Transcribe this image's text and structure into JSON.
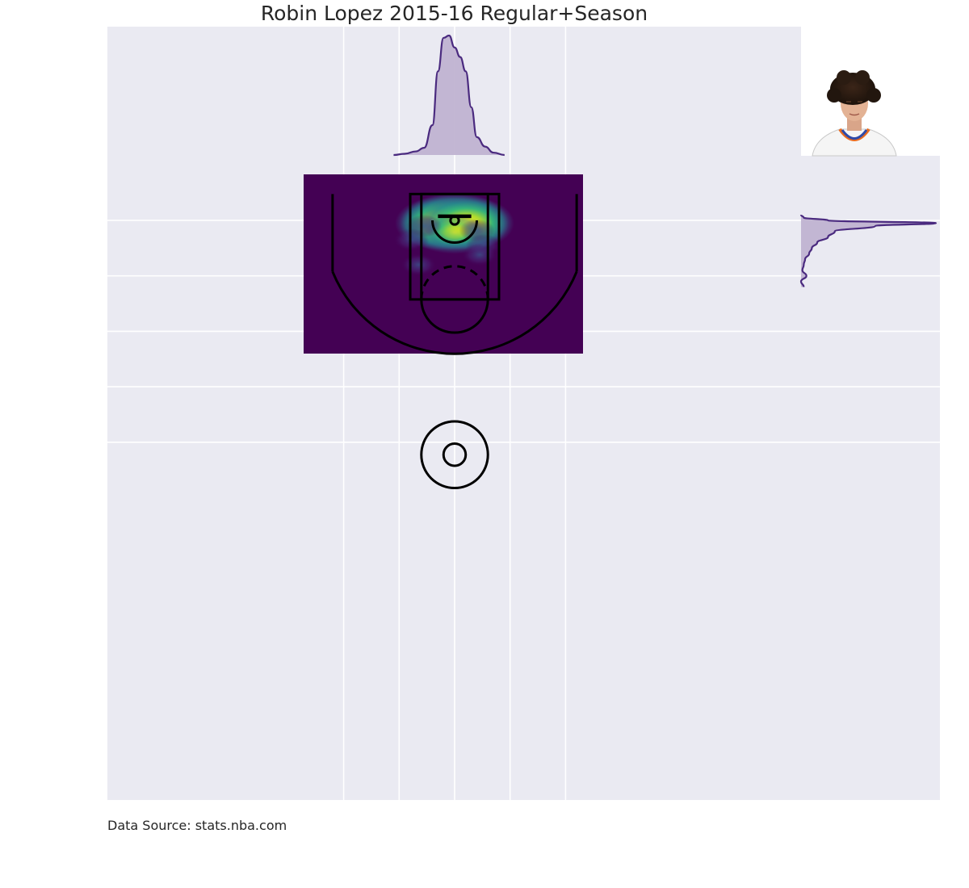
{
  "title": "Robin Lopez 2015-16 Regular+Season",
  "source": "Data Source: stats.nba.com",
  "colors": {
    "background": "#eaeaf2",
    "grid": "#ffffff",
    "court_lines": "#000000",
    "kde_line": "#4a2a7f",
    "kde_fill": "#c0b3d1",
    "heat_low": "#440154",
    "heat_mid": "#21918c",
    "heat_high": "#fde725"
  },
  "chart_data": {
    "type": "heatmap",
    "title": "Robin Lopez 2015-16 Regular+Season",
    "xlabel": "",
    "ylabel": "",
    "xlim": [
      -250,
      250
    ],
    "ylim": [
      422.5,
      -47.5
    ],
    "grid": true,
    "colormap": "viridis",
    "data_extent": {
      "x": [
        -110,
        90
      ],
      "y": [
        -10,
        120
      ]
    },
    "density_peaks": [
      {
        "x": 0,
        "y": 5,
        "intensity": 1.0
      },
      {
        "x": -22,
        "y": 5,
        "intensity": 0.85
      },
      {
        "x": 22,
        "y": 5,
        "intensity": 0.85
      },
      {
        "x": 0,
        "y": 22,
        "intensity": 0.45
      },
      {
        "x": 40,
        "y": 18,
        "intensity": 0.3
      },
      {
        "x": -55,
        "y": 10,
        "intensity": 0.18
      },
      {
        "x": -78,
        "y": 35,
        "intensity": 0.12
      },
      {
        "x": 52,
        "y": 45,
        "intensity": 0.12
      },
      {
        "x": -65,
        "y": 80,
        "intensity": 0.08
      },
      {
        "x": 45,
        "y": 62,
        "intensity": 0.1
      }
    ],
    "marginal_x": {
      "x": [
        -110,
        -90,
        -70,
        -55,
        -40,
        -30,
        -20,
        -10,
        0,
        10,
        20,
        30,
        40,
        55,
        70,
        90
      ],
      "density": [
        0.0,
        0.01,
        0.03,
        0.06,
        0.25,
        0.7,
        0.98,
        1.0,
        0.9,
        0.82,
        0.7,
        0.4,
        0.15,
        0.07,
        0.02,
        0.0
      ]
    },
    "marginal_y": {
      "y": [
        -10,
        -5,
        0,
        5,
        10,
        20,
        30,
        40,
        50,
        60,
        70,
        80,
        90,
        100,
        110,
        120
      ],
      "density": [
        0.0,
        0.02,
        0.2,
        1.0,
        0.55,
        0.25,
        0.2,
        0.12,
        0.08,
        0.06,
        0.03,
        0.02,
        0.01,
        0.04,
        0.0,
        0.02
      ]
    }
  }
}
